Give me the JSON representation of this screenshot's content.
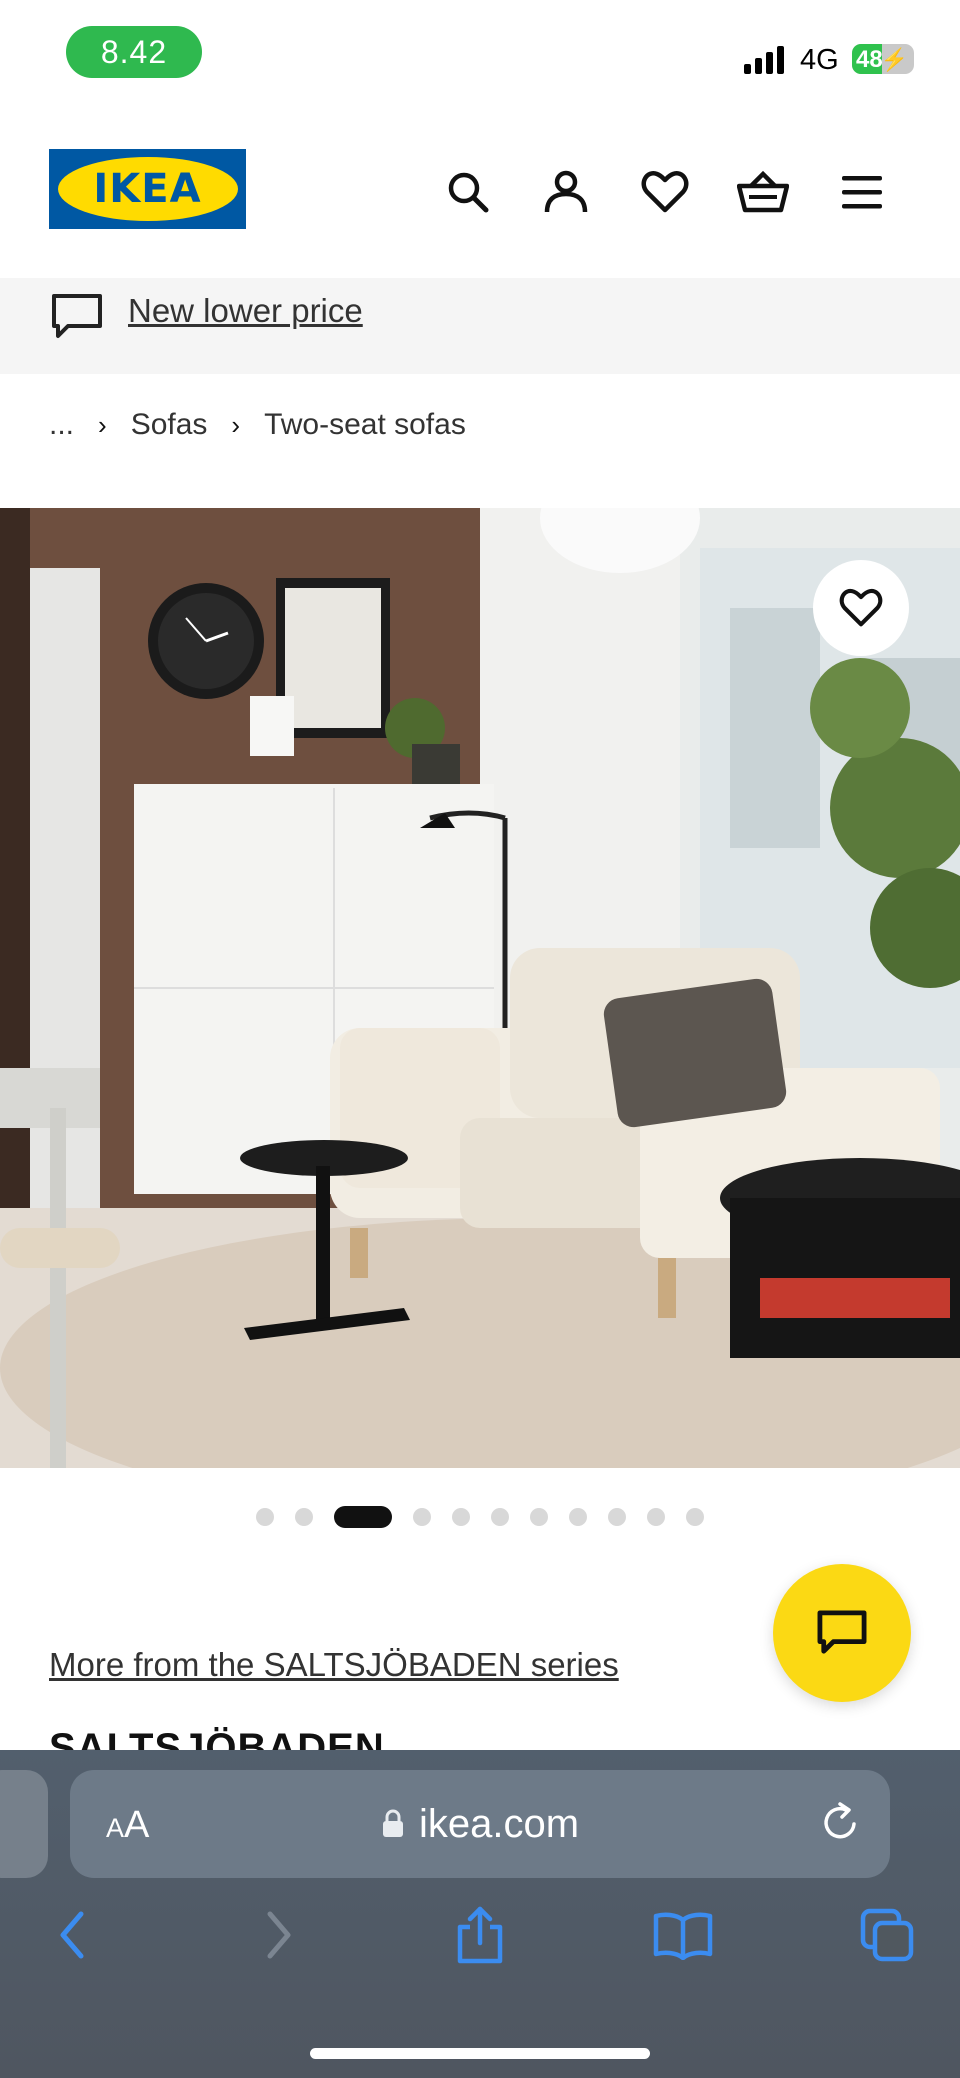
{
  "status_bar": {
    "time": "8.42",
    "network": "4G",
    "battery": "48",
    "battery_level": 0.48
  },
  "header": {
    "logo_text": "IKEA",
    "brand_colors": {
      "blue": "#0058a3",
      "yellow": "#ffdb00"
    }
  },
  "promo": {
    "text": "New lower price"
  },
  "breadcrumb": {
    "items": [
      "...",
      "Sofas",
      "Two-seat sofas"
    ]
  },
  "gallery": {
    "image_count": 11,
    "active_index": 2
  },
  "series_link": "More from the SALTSJÖBADEN series",
  "product_name": "SALTSJÖBADEN",
  "browser": {
    "domain": "ikea.com",
    "text_size_label_small": "A",
    "text_size_label_large": "A"
  },
  "icons": [
    "search-icon",
    "account-icon",
    "heart-icon",
    "basket-icon",
    "menu-icon",
    "chat-icon",
    "reload-icon",
    "lock-icon",
    "back-icon",
    "forward-icon",
    "share-icon",
    "bookmarks-icon",
    "tabs-icon"
  ]
}
